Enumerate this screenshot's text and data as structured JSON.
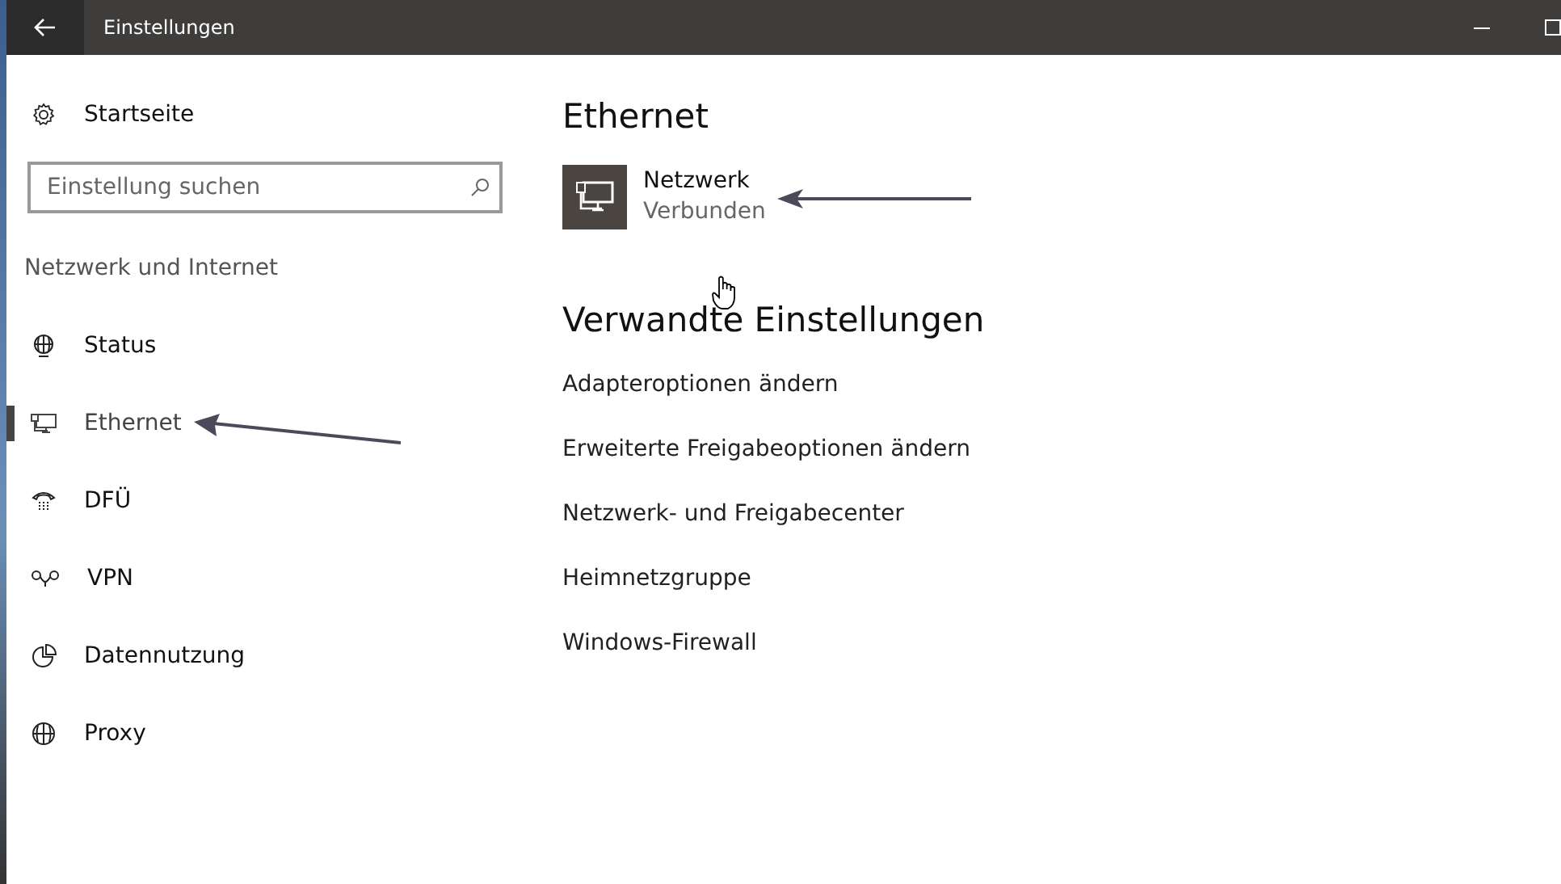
{
  "window": {
    "title": "Einstellungen"
  },
  "sidebar": {
    "home": "Startseite",
    "search": {
      "placeholder": "Einstellung suchen"
    },
    "category": "Netzwerk und Internet",
    "items": [
      {
        "label": "Status",
        "kind": "status",
        "selected": false
      },
      {
        "label": "Ethernet",
        "kind": "ethernet",
        "selected": true
      },
      {
        "label": "DFÜ",
        "kind": "dialup",
        "selected": false
      },
      {
        "label": "VPN",
        "kind": "vpn",
        "selected": false
      },
      {
        "label": "Datennutzung",
        "kind": "data",
        "selected": false
      },
      {
        "label": "Proxy",
        "kind": "proxy",
        "selected": false
      }
    ]
  },
  "content": {
    "heading": "Ethernet",
    "network": {
      "name": "Netzwerk",
      "status": "Verbunden"
    },
    "related_heading": "Verwandte Einstellungen",
    "links": [
      "Adapteroptionen ändern",
      "Erweiterte Freigabeoptionen ändern",
      "Netzwerk- und Freigabecenter",
      "Heimnetzgruppe",
      "Windows-Firewall"
    ]
  }
}
